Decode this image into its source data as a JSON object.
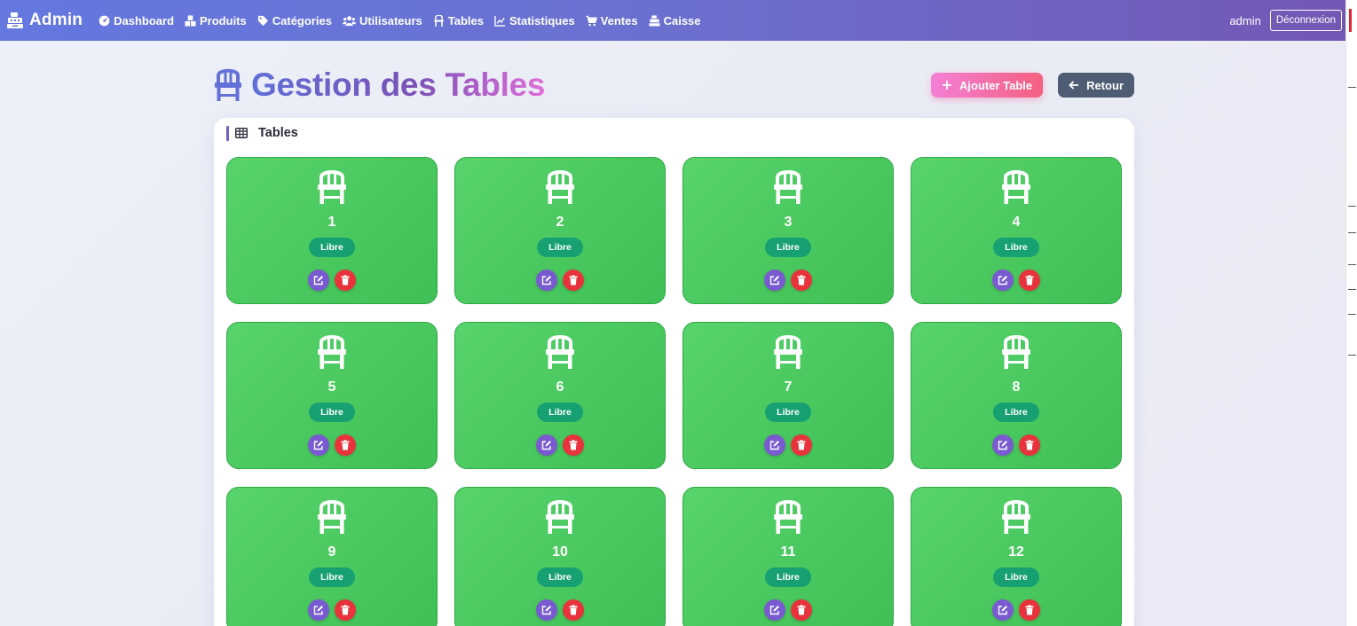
{
  "navbar": {
    "brand": "Admin",
    "links": [
      {
        "label": "Dashboard",
        "icon": "gauge-icon"
      },
      {
        "label": "Produits",
        "icon": "boxes-icon"
      },
      {
        "label": "Catégories",
        "icon": "tags-icon"
      },
      {
        "label": "Utilisateurs",
        "icon": "users-icon"
      },
      {
        "label": "Tables",
        "icon": "chair-icon"
      },
      {
        "label": "Statistiques",
        "icon": "chart-line-icon"
      },
      {
        "label": "Ventes",
        "icon": "cart-icon"
      },
      {
        "label": "Caisse",
        "icon": "cash-register-icon"
      }
    ],
    "user": "admin",
    "logout_label": "Déconnexion"
  },
  "header": {
    "title": "Gestion des Tables",
    "add_label": "Ajouter Table",
    "back_label": "Retour"
  },
  "card": {
    "title": "Tables"
  },
  "tables": [
    {
      "number": "1",
      "status": "Libre"
    },
    {
      "number": "2",
      "status": "Libre"
    },
    {
      "number": "3",
      "status": "Libre"
    },
    {
      "number": "4",
      "status": "Libre"
    },
    {
      "number": "5",
      "status": "Libre"
    },
    {
      "number": "6",
      "status": "Libre"
    },
    {
      "number": "7",
      "status": "Libre"
    },
    {
      "number": "8",
      "status": "Libre"
    },
    {
      "number": "9",
      "status": "Libre"
    },
    {
      "number": "10",
      "status": "Libre"
    },
    {
      "number": "11",
      "status": "Libre"
    },
    {
      "number": "12",
      "status": "Libre"
    }
  ],
  "colors": {
    "nav_start": "#6478e0",
    "nav_end": "#7457b4",
    "tile_green": "#4cc962",
    "badge_green": "#17a072",
    "edit_purple": "#7a5ad0",
    "delete_red": "#e8333d"
  }
}
